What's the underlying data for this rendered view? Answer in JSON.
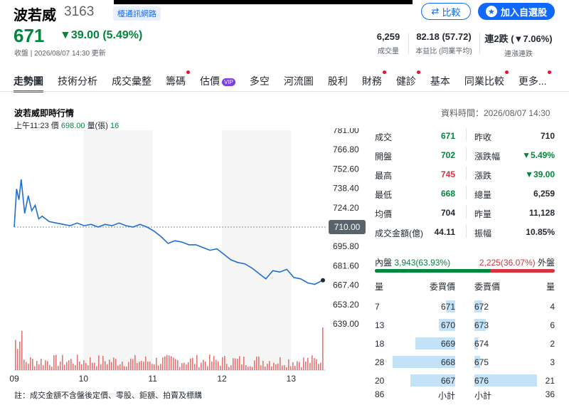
{
  "header": {
    "stock_name": "波若威",
    "stock_code": "3163",
    "industry_tag": "檯通訊網路",
    "compare_label": "比較",
    "add_watchlist_label": "加入自選股",
    "price": "671",
    "change": "▼39.00 (5.49%)",
    "update_time": "收盤 | 2026/08/07 14:30 更新"
  },
  "kpis": [
    {
      "value": "6,259",
      "label": "成交量"
    },
    {
      "value": "82.18 (57.72)",
      "label": "本益比 (同業平均)"
    },
    {
      "value": "連2跌 (▼7.06%)",
      "label": "連漲連跌"
    }
  ],
  "tabs": [
    "走勢圖",
    "技術分析",
    "成交彙整",
    "籌碼",
    "估價",
    "多空",
    "河流圖",
    "股利",
    "財務",
    "健診",
    "基本",
    "同業比較",
    "更多..."
  ],
  "tab_vip_label": "VIP",
  "chart": {
    "title": "波若威即時行情",
    "data_time": "資料時間：2026/08/07 14:30",
    "tick_time": "上午11:23",
    "tick_price_label": "價",
    "tick_price": "698.00",
    "tick_vol_label": "量(張)",
    "tick_vol": "16",
    "ref_price_tag": "710.00",
    "footnote": "註：成交金額不含盤後定價、零股、鉅額、拍賣及標購"
  },
  "chart_data": {
    "type": "line",
    "x_ticks": [
      "09",
      "10",
      "11",
      "12",
      "13"
    ],
    "y_ticks": [
      "781.00",
      "766.80",
      "752.60",
      "738.40",
      "724.20",
      "710.00",
      "695.80",
      "681.60",
      "667.40",
      "653.20",
      "639.00"
    ],
    "ylim": [
      639,
      781
    ],
    "reference": 710,
    "series": [
      {
        "values": [
          [
            0,
            710
          ],
          [
            2,
            738
          ],
          [
            4,
            730
          ],
          [
            6,
            745
          ],
          [
            9,
            720
          ],
          [
            12,
            733
          ],
          [
            15,
            722
          ],
          [
            18,
            726
          ],
          [
            21,
            716
          ],
          [
            24,
            718
          ],
          [
            30,
            714
          ],
          [
            36,
            713
          ],
          [
            42,
            712
          ],
          [
            48,
            711
          ],
          [
            54,
            713
          ],
          [
            60,
            711
          ],
          [
            66,
            712
          ],
          [
            72,
            710
          ],
          [
            78,
            712
          ],
          [
            84,
            711
          ],
          [
            90,
            713
          ],
          [
            96,
            711
          ],
          [
            102,
            710
          ],
          [
            108,
            712
          ],
          [
            114,
            710
          ],
          [
            120,
            707
          ],
          [
            126,
            703
          ],
          [
            132,
            698
          ],
          [
            138,
            700
          ],
          [
            144,
            699
          ],
          [
            150,
            697
          ],
          [
            156,
            697
          ],
          [
            162,
            695
          ],
          [
            168,
            693
          ],
          [
            174,
            694
          ],
          [
            180,
            690
          ],
          [
            186,
            686
          ],
          [
            192,
            684
          ],
          [
            198,
            683
          ],
          [
            204,
            680
          ],
          [
            210,
            676
          ],
          [
            216,
            672
          ],
          [
            222,
            678
          ],
          [
            228,
            677
          ],
          [
            234,
            679
          ],
          [
            240,
            673
          ],
          [
            246,
            672
          ],
          [
            252,
            669
          ],
          [
            258,
            668
          ],
          [
            265,
            671
          ]
        ]
      }
    ],
    "volume": "bars"
  },
  "quote": [
    {
      "k": "成交",
      "v": "671",
      "c": "green",
      "k2": "昨收",
      "v2": "710",
      "c2": "black"
    },
    {
      "k": "開盤",
      "v": "702",
      "c": "green",
      "k2": "漲跌幅",
      "v2": "▼5.49%",
      "c2": "green"
    },
    {
      "k": "最高",
      "v": "745",
      "c": "red",
      "k2": "漲跌",
      "v2": "▼39.00",
      "c2": "green"
    },
    {
      "k": "最低",
      "v": "668",
      "c": "green",
      "k2": "總量",
      "v2": "6,259",
      "c2": "black"
    },
    {
      "k": "均價",
      "v": "704",
      "c": "black",
      "k2": "昨量",
      "v2": "11,128",
      "c2": "black"
    },
    {
      "k": "成交金額(億)",
      "v": "44.11",
      "c": "black",
      "k2": "振幅",
      "v2": "10.85%",
      "c2": "black"
    }
  ],
  "inout": {
    "inner_label": "內盤",
    "inner_value": "3,943(63.93%)",
    "inner_pct": 0.6393,
    "outer_value": "2,225(36.07%)",
    "outer_label": "外盤"
  },
  "orderbook": {
    "headers": [
      "量",
      "委買價",
      "委賣價",
      "量"
    ],
    "rows": [
      {
        "bv": "7",
        "bp": "671",
        "sp": "672",
        "sv": "4",
        "bw": 0.14,
        "sw": 0.12
      },
      {
        "bv": "13",
        "bp": "670",
        "sp": "673",
        "sv": "6",
        "bw": 0.26,
        "sw": 0.18
      },
      {
        "bv": "18",
        "bp": "669",
        "sp": "674",
        "sv": "2",
        "bw": 0.62,
        "sw": 0.06
      },
      {
        "bv": "28",
        "bp": "668",
        "sp": "675",
        "sv": "3",
        "bw": 0.98,
        "sw": 0.09
      },
      {
        "bv": "20",
        "bp": "667",
        "sp": "676",
        "sv": "21",
        "bw": 0.7,
        "sw": 0.98
      }
    ],
    "total_buy": "86",
    "total_buy_label": "小計",
    "total_sell_label": "小計",
    "total_sell": "36"
  }
}
